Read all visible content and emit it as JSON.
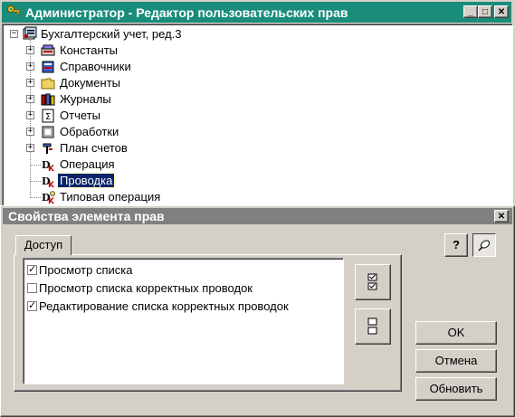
{
  "window": {
    "title": "Администратор - Редактор пользовательских прав",
    "controls": {
      "minimize": "_",
      "maximize": "□",
      "close": "✕"
    }
  },
  "tree": {
    "root": {
      "label": "Бухгалтерский учет, ред.3",
      "expander": "−",
      "icon": "database-icon"
    },
    "items": [
      {
        "label": "Константы",
        "expander": "+",
        "icon": "constants-icon",
        "selected": false
      },
      {
        "label": "Справочники",
        "expander": "+",
        "icon": "catalogs-icon",
        "selected": false
      },
      {
        "label": "Документы",
        "expander": "+",
        "icon": "folder-icon",
        "selected": false
      },
      {
        "label": "Журналы",
        "expander": "+",
        "icon": "journals-icon",
        "selected": false
      },
      {
        "label": "Отчеты",
        "expander": "+",
        "icon": "reports-icon",
        "selected": false
      },
      {
        "label": "Обработки",
        "expander": "+",
        "icon": "processing-icon",
        "selected": false
      },
      {
        "label": "План счетов",
        "expander": "+",
        "icon": "chart-of-accounts-icon",
        "selected": false
      },
      {
        "label": "Операция",
        "expander": "",
        "icon": "operation-icon",
        "selected": false
      },
      {
        "label": "Проводка",
        "expander": "",
        "icon": "posting-icon",
        "selected": true
      },
      {
        "label": "Типовая операция",
        "expander": "",
        "icon": "typical-operation-icon",
        "selected": false
      }
    ]
  },
  "properties": {
    "title": "Свойства элемента прав",
    "close": "✕",
    "tab": "Доступ",
    "help_icon": "?",
    "permissions": [
      {
        "label": "Просмотр списка",
        "checked": true
      },
      {
        "label": "Просмотр списка корректных проводок",
        "checked": false
      },
      {
        "label": "Редактирование списка корректных проводок",
        "checked": true
      }
    ],
    "buttons": {
      "ok": "OK",
      "cancel": "Отмена",
      "refresh": "Обновить"
    }
  },
  "colors": {
    "title_active": "#1a8c7c",
    "title_inactive": "#808080",
    "selection": "#0a246a",
    "face": "#d4d0c8"
  }
}
